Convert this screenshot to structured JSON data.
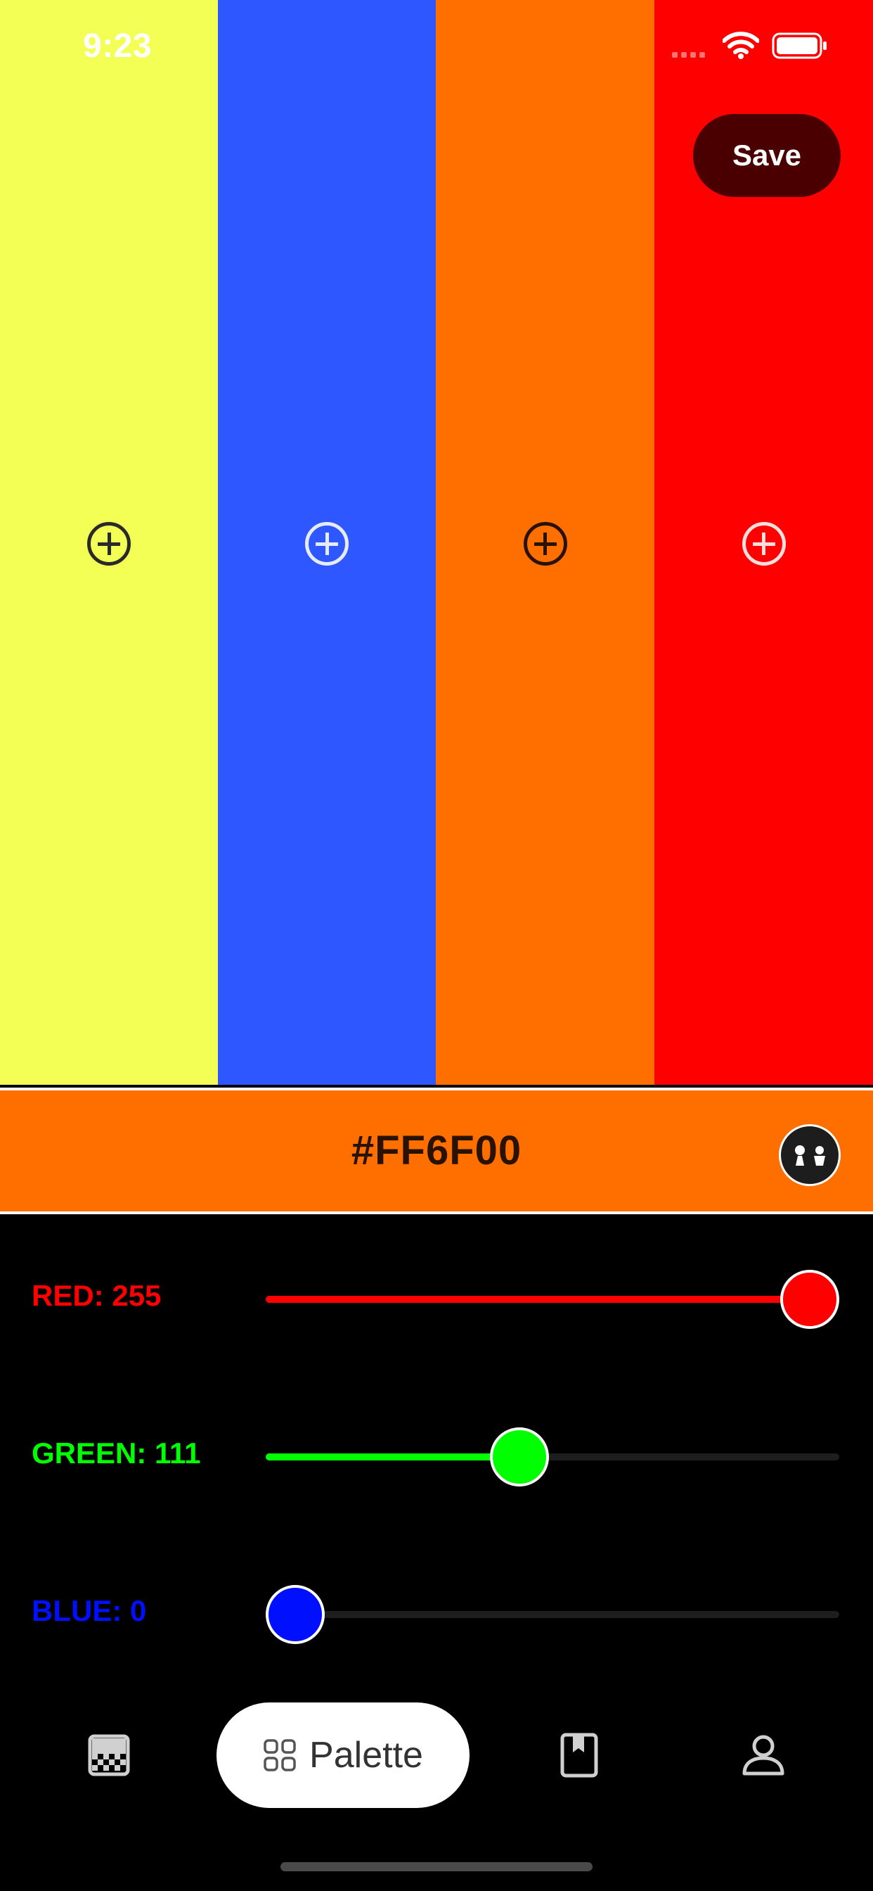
{
  "status_bar": {
    "time": "9:23"
  },
  "palette": {
    "colors": [
      {
        "hex": "#F3FF55",
        "icon_color": "#2a2a2a"
      },
      {
        "hex": "#2F57FF",
        "icon_color": "#e6ecff"
      },
      {
        "hex": "#FF6F00",
        "icon_color": "#2a1200"
      },
      {
        "hex": "#FF0000",
        "icon_color": "#ffdede"
      }
    ],
    "add_icon": "plus-circle-icon"
  },
  "header": {
    "save_label": "Save"
  },
  "selected": {
    "hex_label": "#FF6F00",
    "picker_icon": "eyedropper-icon"
  },
  "sliders": [
    {
      "label": "RED: 255",
      "value": 255,
      "max": 255,
      "color": "#ff0000"
    },
    {
      "label": "GREEN: 111",
      "value": 111,
      "max": 255,
      "color": "#00ff00"
    },
    {
      "label": "BLUE: 0",
      "value": 0,
      "max": 255,
      "color": "#0010ff"
    }
  ],
  "tab_bar": {
    "items": [
      {
        "icon": "gradient-icon"
      },
      {
        "icon": "grid-icon",
        "label": "Palette",
        "active": true
      },
      {
        "icon": "bookmark-icon"
      },
      {
        "icon": "person-icon"
      }
    ]
  }
}
